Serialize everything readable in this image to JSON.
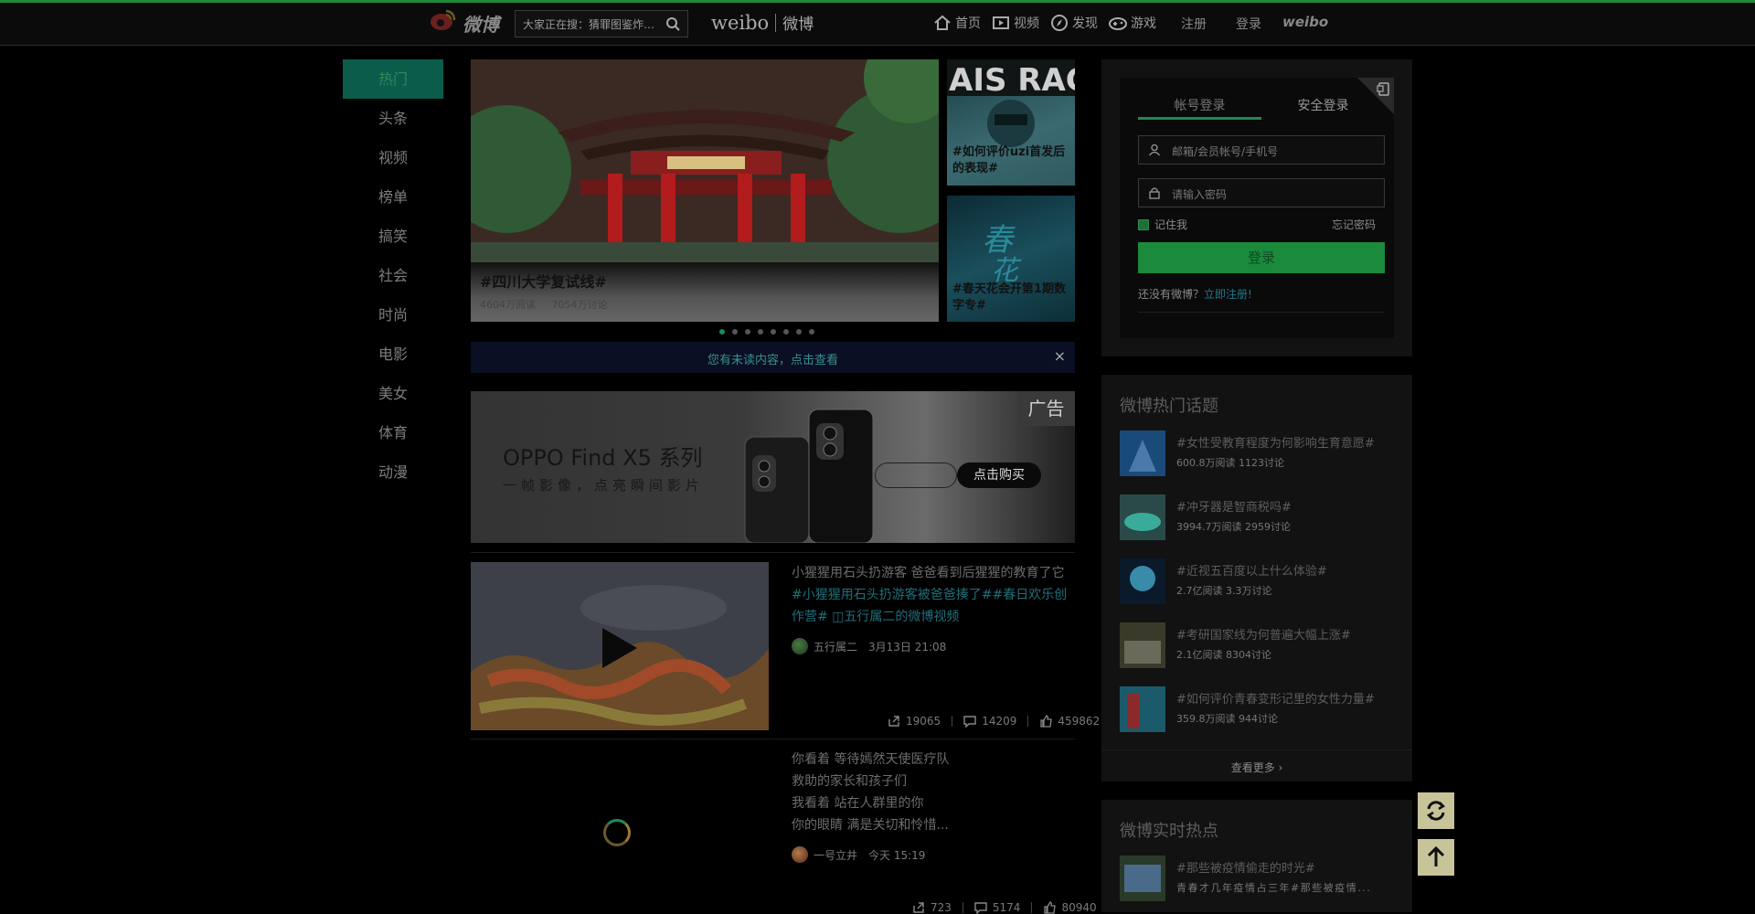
{
  "topbar": {
    "logo_text": "微博",
    "search_placeholder": "大家正在搜：猜罪图鉴炸…",
    "brand": "weibo",
    "brand_cn": "微博",
    "nav": [
      {
        "label": "首页",
        "icon": "home-icon"
      },
      {
        "label": "视频",
        "icon": "video-icon"
      },
      {
        "label": "发现",
        "icon": "compass-icon"
      },
      {
        "label": "游戏",
        "icon": "gamepad-icon"
      }
    ],
    "register": "注册",
    "login": "登录",
    "weibo_small": "weibo"
  },
  "leftnav": [
    "热门",
    "头条",
    "视频",
    "榜单",
    "搞笑",
    "社会",
    "时尚",
    "电影",
    "美女",
    "体育",
    "动漫"
  ],
  "hero": {
    "title": "#四川大学复试线#",
    "reads": "4604万阅读",
    "discussions": "7054万讨论"
  },
  "thumbs": [
    {
      "title": "#如何评价uzi首发后的表现#"
    },
    {
      "title": "#春天花会开第1期数字专#"
    }
  ],
  "notice": {
    "text": "您有未读内容，点击查看",
    "close": "×"
  },
  "ad": {
    "tag": "广告",
    "title": "OPPO Find X5 系列",
    "subtitle": "一帧影像，点亮瞬间影片",
    "button": "点击购买"
  },
  "feed": [
    {
      "text": "小猩猩用石头扔游客 爸爸看到后猩猩的教育了它",
      "link": "#小猩猩用石头扔游客被爸爸揍了##春日欢乐创作营#",
      "video_link": "五行属二的微博视频",
      "author": "五行属二",
      "time": "3月13日 21:08",
      "shares": "19065",
      "comments": "14209",
      "likes": "459862"
    },
    {
      "lines": [
        "你看着 等待嫣然天使医疗队",
        "救助的家长和孩子们",
        "我看着 站在人群里的你",
        "你的眼睛 满是关切和怜惜..."
      ],
      "author": "一号立井",
      "time": "今天 15:19",
      "shares": "723",
      "comments": "5174",
      "likes": "80940"
    }
  ],
  "login": {
    "tab_account": "帐号登录",
    "tab_secure": "安全登录",
    "username_placeholder": "邮箱/会员帐号/手机号",
    "password_placeholder": "请输入密码",
    "remember": "记住我",
    "forgot": "忘记密码",
    "button": "登录",
    "no_account": "还没有微博？",
    "register_now": "立即注册!"
  },
  "hot_topics": {
    "title": "微博热门话题",
    "items": [
      {
        "name": "#女性受教育程度为何影响生育意愿#",
        "meta": "600.8万阅读 1123讨论"
      },
      {
        "name": "#冲牙器是智商税吗#",
        "meta": "3994.7万阅读 2959讨论"
      },
      {
        "name": "#近视五百度以上什么体验#",
        "meta": "2.7亿阅读 3.3万讨论"
      },
      {
        "name": "#考研国家线为何普遍大幅上涨#",
        "meta": "2.1亿阅读 8304讨论"
      },
      {
        "name": "#如何评价青春变形记里的女性力量#",
        "meta": "359.8万阅读 944讨论"
      }
    ],
    "more": "查看更多 ›"
  },
  "realtime": {
    "title": "微博实时热点",
    "items": [
      {
        "name": "#那些被疫情偷走的时光#",
        "meta": "青春才几年疫情占三年#那些被疫情..."
      }
    ]
  },
  "colors": {
    "accent_green": "#1b8a3c",
    "link_teal": "#1f7a8a",
    "background": "#000000"
  }
}
